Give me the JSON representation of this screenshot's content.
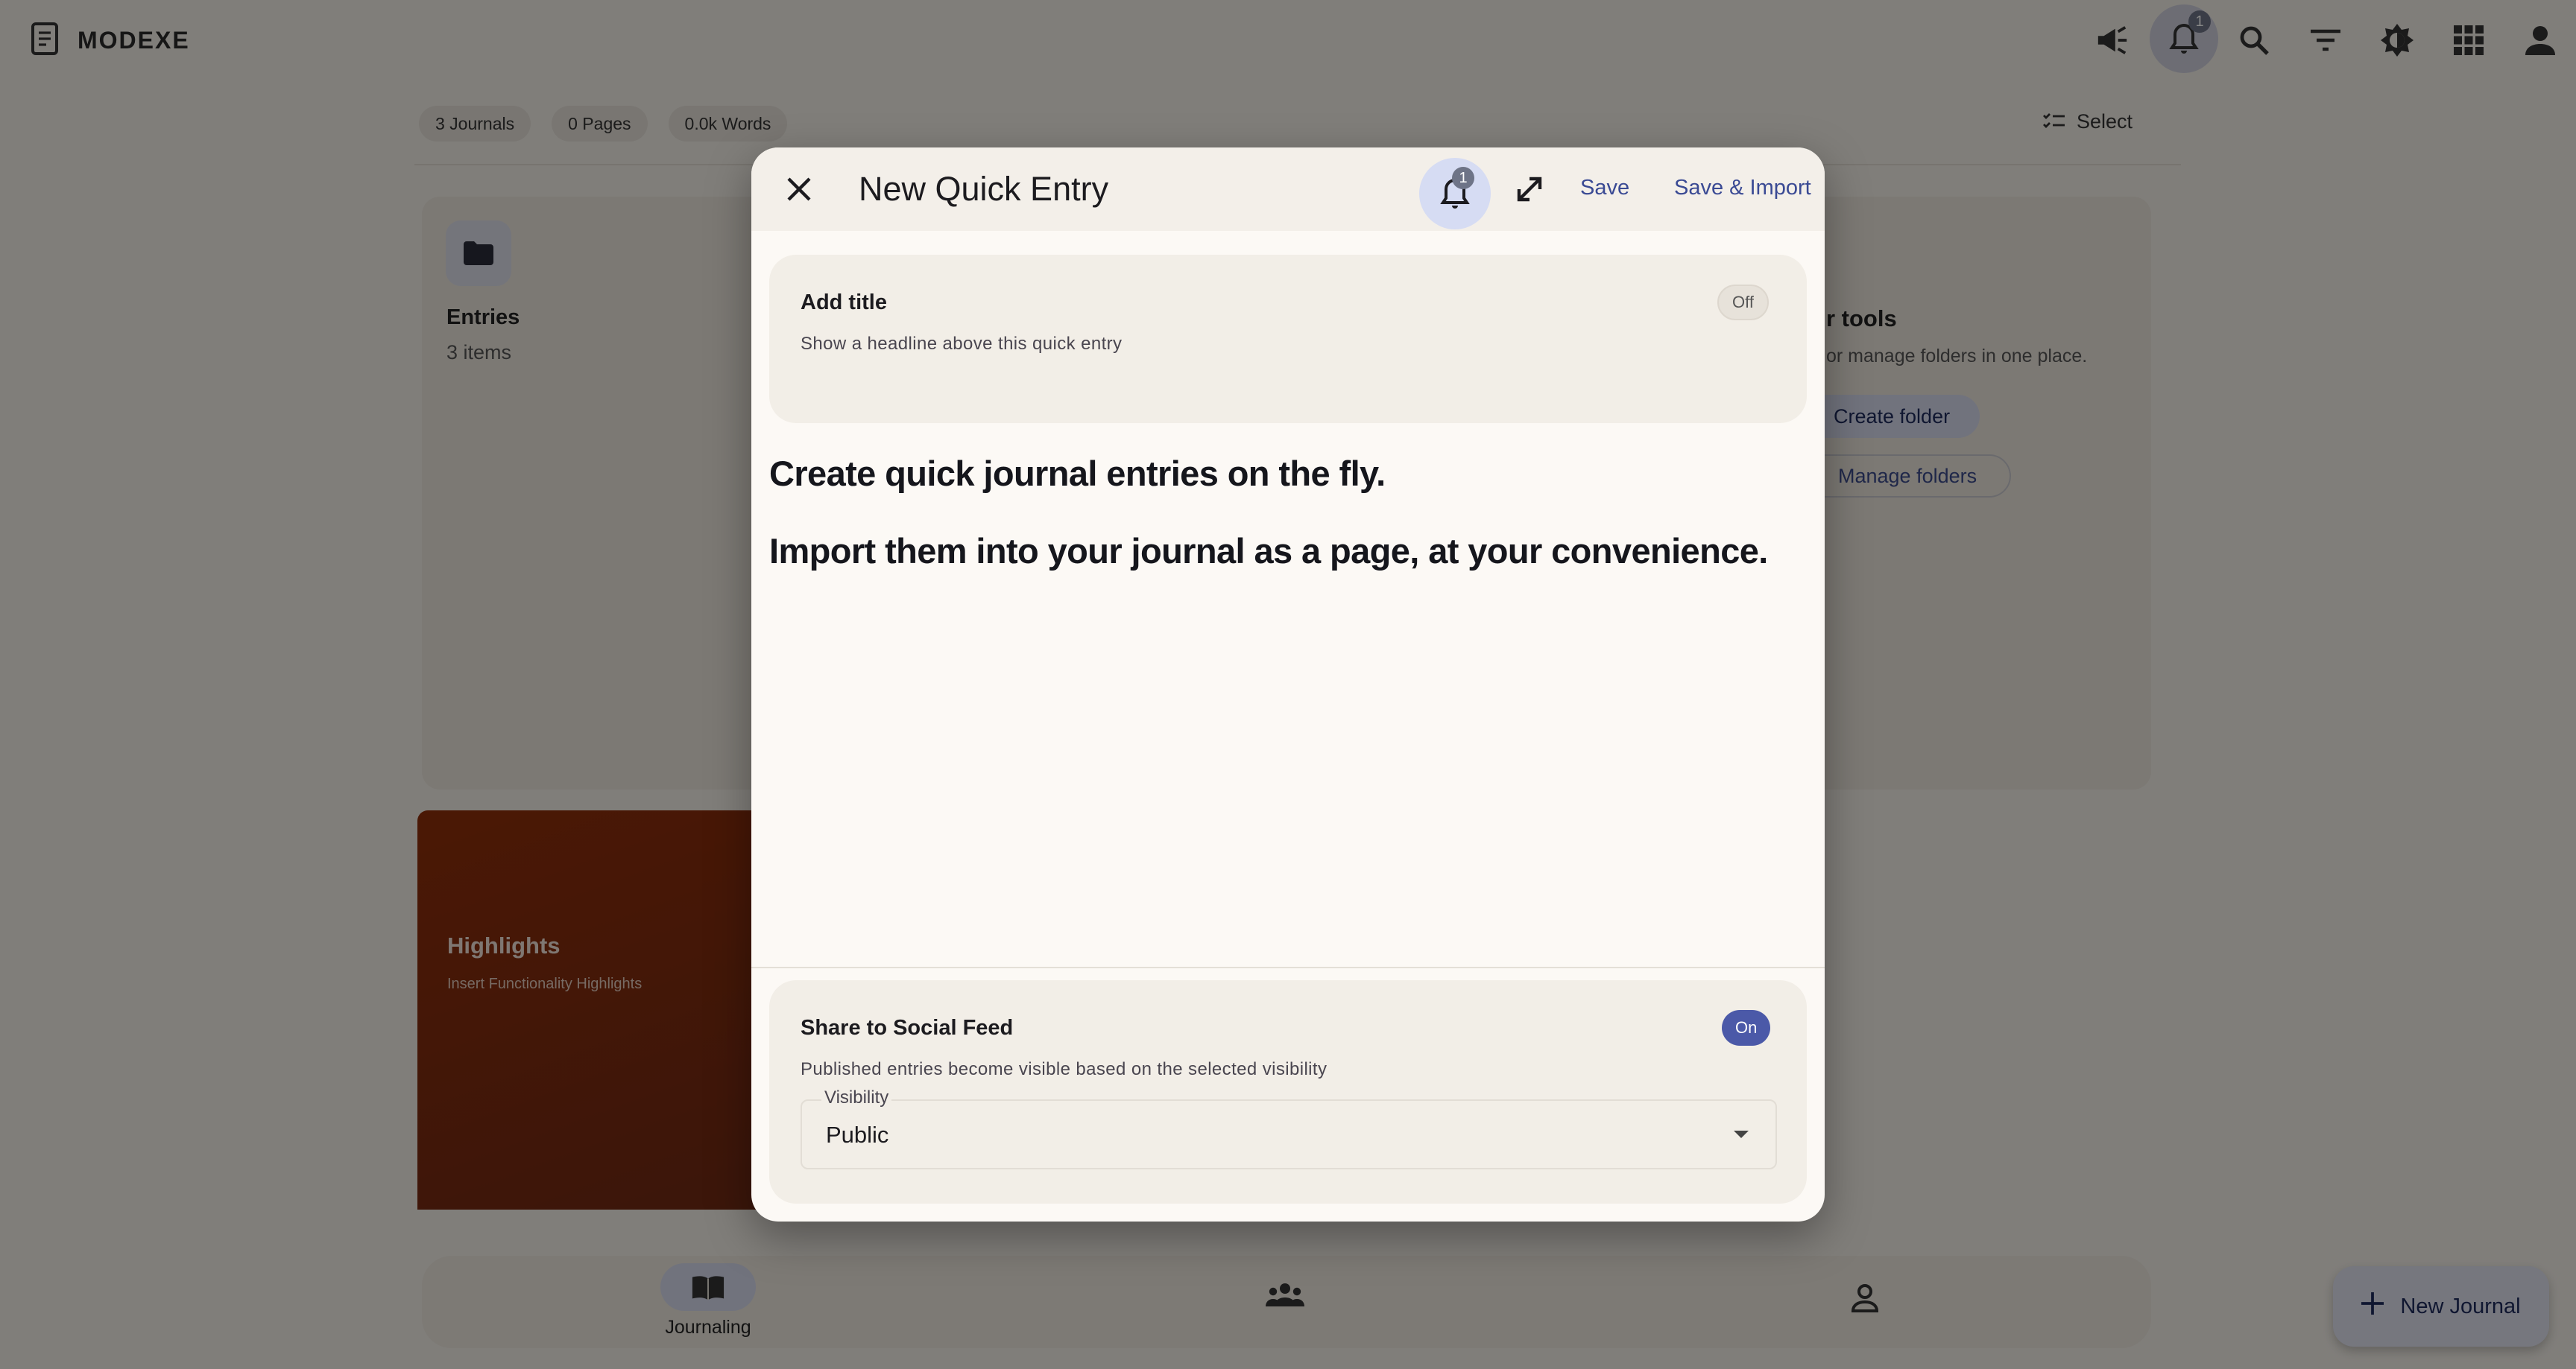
{
  "app": {
    "brand": "MODEXE",
    "notification_count": "1"
  },
  "stats": {
    "journals": "3 Journals",
    "pages": "0 Pages",
    "words": "0.0k Words"
  },
  "toolbar": {
    "select_label": "Select"
  },
  "entries_card": {
    "title": "Entries",
    "subtitle": "3 items"
  },
  "tools_card": {
    "title": "r tools",
    "subtitle": "or manage folders in one place.",
    "create_folder": "Create folder",
    "manage_folders": "Manage folders"
  },
  "highlights_card": {
    "title": "Highlights",
    "subtitle": "Insert Functionality Highlights"
  },
  "bottom_nav": {
    "journaling": "Journaling"
  },
  "fab": {
    "label": "New Journal"
  },
  "dialog": {
    "title": "New Quick Entry",
    "notification_count": "1",
    "save": "Save",
    "save_import": "Save & Import",
    "add_title": {
      "label": "Add title",
      "description": "Show a headline above this quick entry",
      "toggle": "Off"
    },
    "body_lines": [
      "Create quick journal entries on the fly.",
      "Import them into your journal as a page, at your convenience."
    ],
    "share": {
      "label": "Share to Social Feed",
      "description": "Published entries become visible based on the selected visibility",
      "toggle": "On"
    },
    "visibility": {
      "label": "Visibility",
      "value": "Public"
    }
  },
  "colors": {
    "accent": "#4b59a8",
    "highlights_bg": "#8e2e0a",
    "scrim": "rgba(0,0,0,0.47)"
  }
}
